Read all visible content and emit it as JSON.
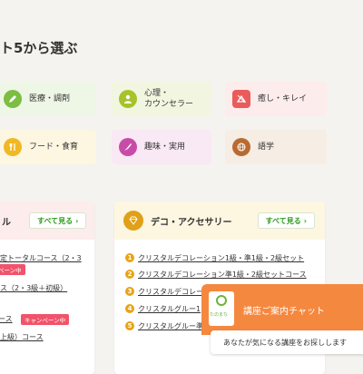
{
  "section": {
    "heading": "ト5から選ぶ"
  },
  "categories": [
    {
      "label": "医療・調剤",
      "icon": "pen-icon",
      "color": "#7cbd42",
      "bg": "#eef6e6"
    },
    {
      "label": "心理・\nカウンセラー",
      "icon": "person-icon",
      "color": "#a7c22b",
      "bg": "#f2f6e1"
    },
    {
      "label": "癒し・キレイ",
      "icon": "spa-icon",
      "color": "#ea5b5b",
      "bg": "#fdecec"
    },
    {
      "label": "フード・食育",
      "icon": "utensils-icon",
      "color": "#efb825",
      "bg": "#fdf6e1"
    },
    {
      "label": "趣味・実用",
      "icon": "hobby-icon",
      "color": "#c84ca7",
      "bg": "#f9e9f4"
    },
    {
      "label": "語学",
      "icon": "globe-icon",
      "color": "#b86b31",
      "bg": "#f6ede4"
    }
  ],
  "left_card": {
    "title": "ル",
    "see_all": "すべて見る",
    "items": [
      {
        "text": "定トータルコース（2・3"
      },
      {
        "text": "ペーン中"
      },
      {
        "text": "ス（2・3級＋初級）"
      },
      {
        "text": "ース",
        "badge": "キャンペーン中"
      },
      {
        "text": "上級）コース"
      }
    ]
  },
  "right_card": {
    "title": "デコ・アクセサリー",
    "see_all": "すべて見る",
    "icon": "diamond-icon",
    "accent": "#e0a017",
    "items": [
      {
        "num": "1",
        "text": "クリスタルデコレーション1級・準1級・2級セット"
      },
      {
        "num": "2",
        "text": "クリスタルデコレーション準1級・2級セットコース"
      },
      {
        "num": "3",
        "text": "クリスタルデコレー"
      },
      {
        "num": "4",
        "text": "クリスタルグルー1"
      },
      {
        "num": "5",
        "text": "クリスタルグルー準"
      }
    ]
  },
  "chat": {
    "brand": "たのまな",
    "title": "講座ご案内チャット",
    "message": "あなたが気になる講座をお探しします"
  }
}
